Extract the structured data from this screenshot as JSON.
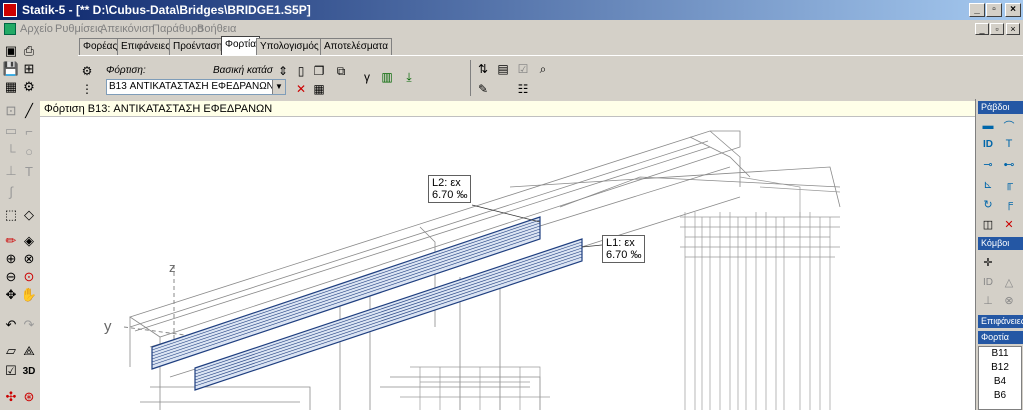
{
  "window": {
    "title": "Statik-5 - [** D:\\Cubus-Data\\Bridges\\BRIDGE1.S5P]",
    "min_label": "_",
    "max_label": "▫",
    "close_label": "×"
  },
  "menu": [
    "Αρχείο",
    "Ρυθμίσεις",
    "Απεικόνιση",
    "Παράθυρο",
    "Βοήθεια"
  ],
  "tabs": [
    {
      "label": "Φορέας",
      "active": false
    },
    {
      "label": "Επιφάνειες",
      "active": false
    },
    {
      "label": "Προένταση",
      "active": false
    },
    {
      "label": "Φορτία",
      "active": true
    },
    {
      "label": "Υπολογισμός",
      "active": false
    },
    {
      "label": "Αποτελέσματα",
      "active": false
    }
  ],
  "load_panel": {
    "field_label": "Φόρτιση:",
    "category_label": "Βασική κατάσ",
    "selected_load": "B13  ΑΝΤΙΚΑΤΑΣΤΑΣΗ ΕΦΕΔΡΑΝΩΝ"
  },
  "status": {
    "current_load": "Φόρτιση B13: ΑΝΤΙΚΑΤΑΣΤΑΣΗ ΕΦΕΔΡΑΝΩΝ"
  },
  "labels": {
    "L2_name": "L2: εx",
    "L2_value": "6.70 ‰",
    "L1_name": "L1: εx",
    "L1_value": "6.70 ‰",
    "axis_z": "z",
    "axis_y": "y"
  },
  "right_panel": {
    "rods_title": "Ράβδοι",
    "nodes_title": "Κόμβοι",
    "surfaces_title": "Επιφάνειες",
    "loads_title": "Φορτία",
    "id_label": "ID",
    "loads_list": [
      "B11",
      "B12",
      "B4",
      "B6"
    ]
  },
  "left_toolbar": {
    "view3d_label": "3D"
  },
  "colors": {
    "title_start": "#0a246a",
    "title_end": "#a6caf0",
    "load_stroke": "#1f3f80",
    "panel_head": "#2457a4"
  }
}
